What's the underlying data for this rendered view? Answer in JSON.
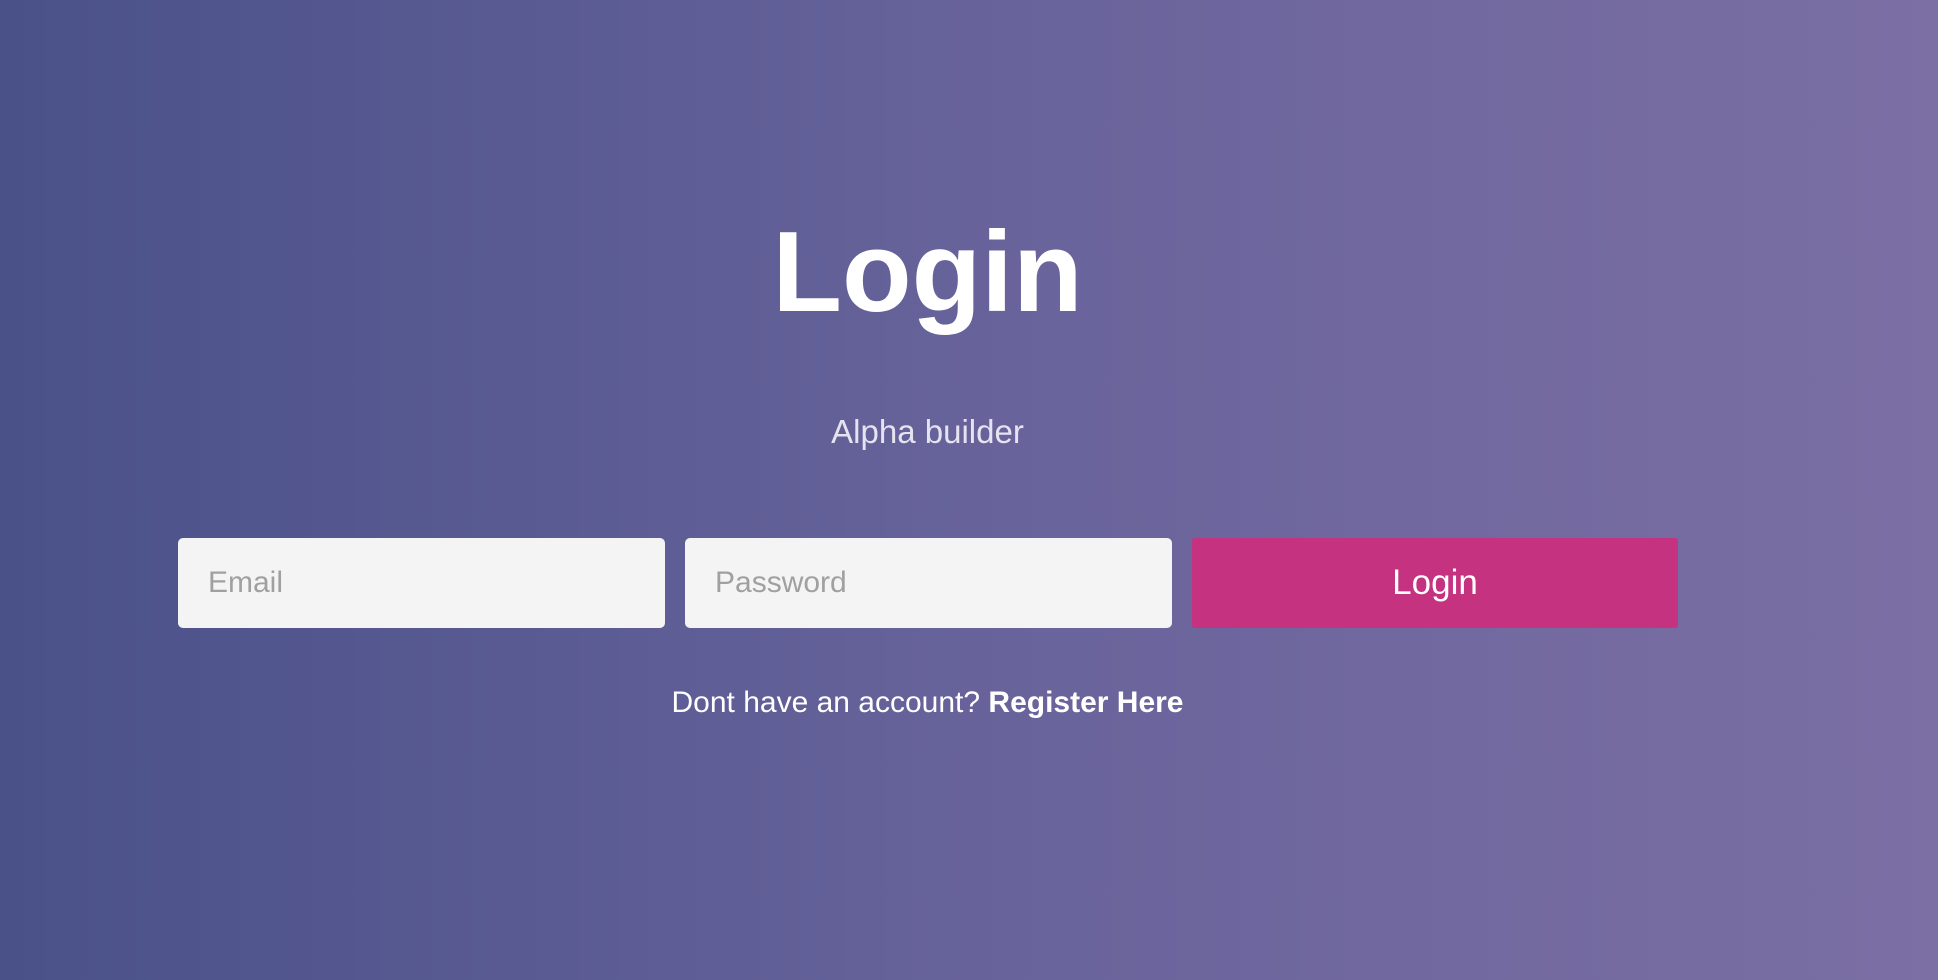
{
  "page": {
    "title": "Login",
    "subtitle": "Alpha builder"
  },
  "form": {
    "email_placeholder": "Email",
    "email_value": "",
    "password_placeholder": "Password",
    "password_value": "",
    "submit_label": "Login"
  },
  "footer": {
    "prompt": "Dont have an account?",
    "register_link": "Register Here"
  },
  "colors": {
    "background_start": "#4a5189",
    "background_end": "#7b6fa4",
    "button": "#c5327f",
    "input_bg": "#f4f4f4"
  }
}
